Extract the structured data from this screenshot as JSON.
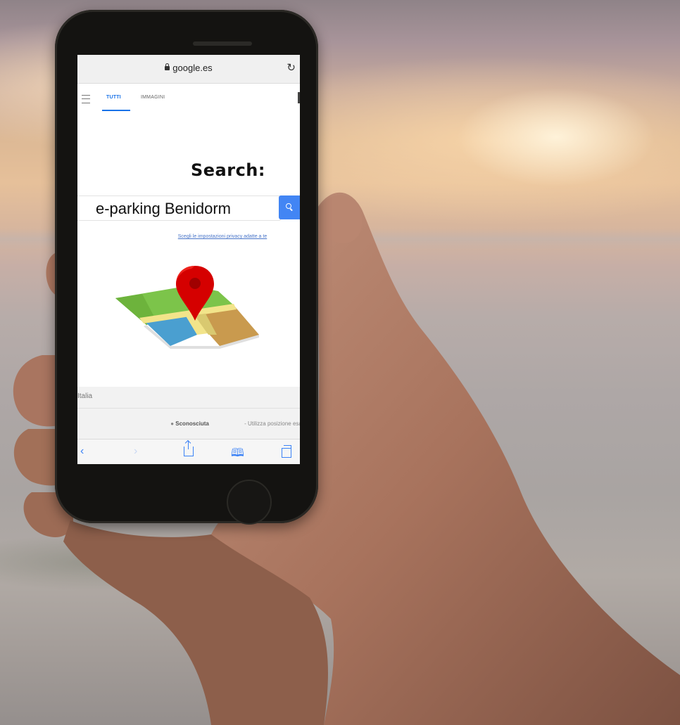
{
  "browser": {
    "domain": "google.es",
    "lock_icon": "lock-icon",
    "reload_icon": "reload-icon"
  },
  "nav": {
    "menu_icon": "hamburger-menu-icon",
    "tabs": [
      {
        "label": "TUTTI",
        "active": true
      },
      {
        "label": "IMMAGINI",
        "active": false
      }
    ]
  },
  "main": {
    "heading": "Search:",
    "search_query": "e-parking Benidorm",
    "search_icon": "search-icon",
    "privacy_link": "Scegli le impostazioni privacy adatte a te",
    "illustration": "map-with-location-pin"
  },
  "footer": {
    "country": "Italia",
    "location_status": "Sconosciuta",
    "location_action": " - Utilizza posizione esatta"
  },
  "toolbar": {
    "icons": [
      "back-icon",
      "forward-icon",
      "share-icon",
      "bookmarks-icon",
      "tabs-icon"
    ]
  },
  "colors": {
    "accent": "#4285f4",
    "pin": "#d50000",
    "map_green": "#7cc44a",
    "map_blue": "#4a9fd0",
    "map_tan": "#c99a4e",
    "map_road": "#f2e48a"
  }
}
